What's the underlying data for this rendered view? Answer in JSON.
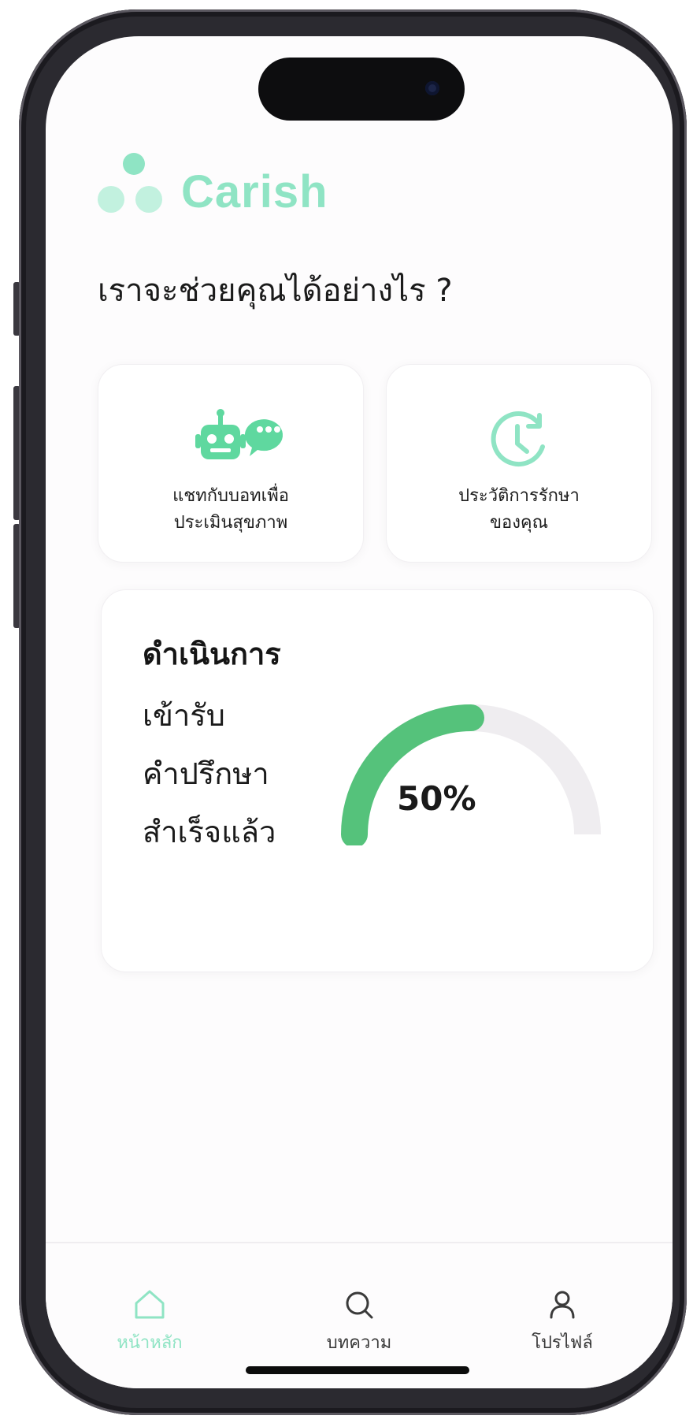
{
  "app": {
    "brand": "Carish",
    "brand_color": "#8fe4c4",
    "logo_icon": "three-dots-logo"
  },
  "main": {
    "headline": "เราจะช่วยคุณได้อย่างไร ?",
    "actions": [
      {
        "label_line1": "แชทกับบอทเพื่อ",
        "label_line2": "ประเมินสุขภาพ",
        "icon": "robot-chat-icon"
      },
      {
        "label_line1": "ประวัติการรักษา",
        "label_line2": "ของคุณ",
        "icon": "history-clock-icon"
      }
    ],
    "progress": {
      "title": "ดำเนินการ",
      "line1": "เข้ารับ",
      "line2": "คำปรึกษา",
      "line3": "สำเร็จแล้ว",
      "percent_label": "50%",
      "percent_value": 50,
      "fill_color": "#55c27b",
      "track_color": "#efedf0"
    }
  },
  "tabbar": {
    "items": [
      {
        "label": "หน้าหลัก",
        "icon": "home-icon",
        "active": true
      },
      {
        "label": "บทความ",
        "icon": "search-icon",
        "active": false
      },
      {
        "label": "โปรไฟล์",
        "icon": "person-icon",
        "active": false
      }
    ]
  }
}
